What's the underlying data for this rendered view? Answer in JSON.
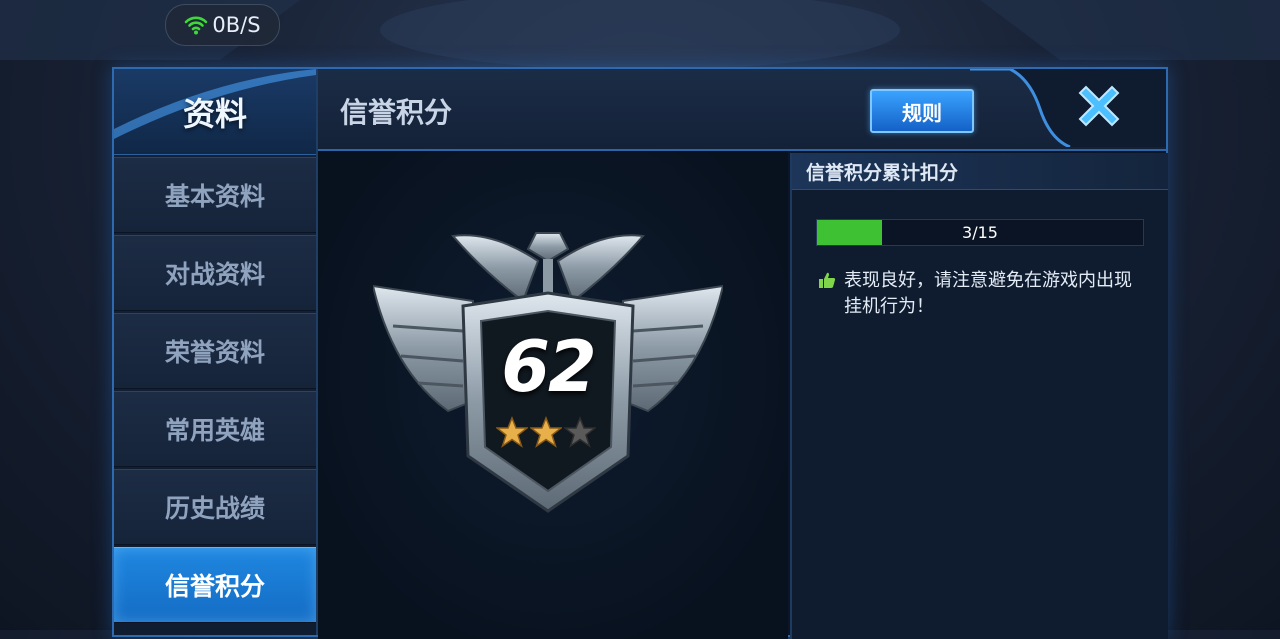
{
  "status_bar": {
    "network_speed": "0B/S",
    "icon": "wifi-icon",
    "icon_color": "#3fd83a"
  },
  "sidebar": {
    "title": "资料",
    "items": [
      {
        "label": "基本资料",
        "active": false
      },
      {
        "label": "对战资料",
        "active": false
      },
      {
        "label": "荣誉资料",
        "active": false
      },
      {
        "label": "常用英雄",
        "active": false
      },
      {
        "label": "历史战绩",
        "active": false
      },
      {
        "label": "信誉积分",
        "active": true
      }
    ]
  },
  "header": {
    "title": "信誉积分",
    "rules_label": "规则",
    "close_icon": "close-icon"
  },
  "badge": {
    "score": "62",
    "stars_filled": 2,
    "stars_total": 3
  },
  "deductions": {
    "title": "信誉积分累计扣分",
    "progress_text": "3/15",
    "progress_current": 3,
    "progress_max": 15,
    "note": "表现良好，请注意避免在游戏内出现挂机行为！",
    "note_icon": "thumbs-up-icon"
  },
  "colors": {
    "accent": "#1f87e0",
    "progress": "#3ec133",
    "star_gold": "#e8b04a"
  }
}
